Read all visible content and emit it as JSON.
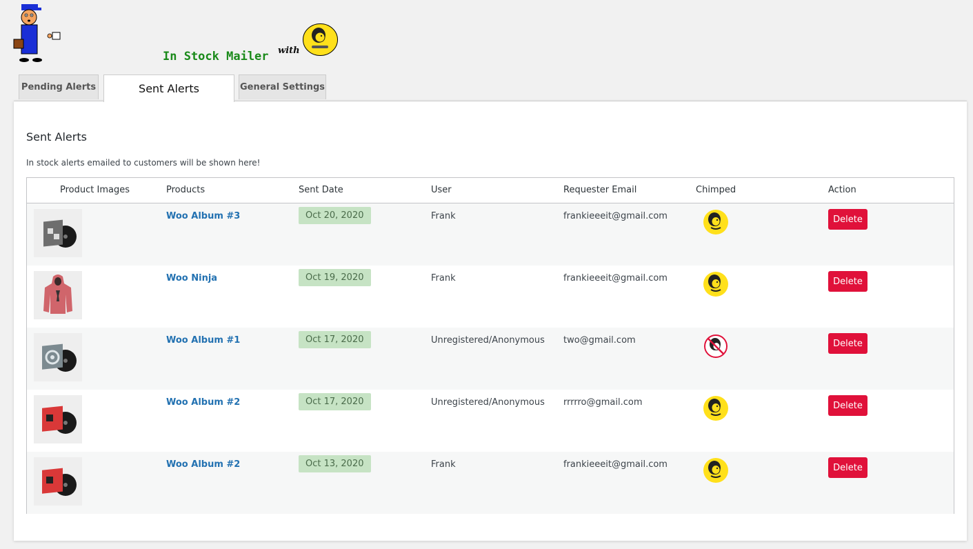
{
  "brand": {
    "title": "In Stock Mailer",
    "with_text": "with"
  },
  "tabs": [
    {
      "label": "Pending Alerts",
      "active": false
    },
    {
      "label": "Sent Alerts",
      "active": true
    },
    {
      "label": "General Settings",
      "active": false
    }
  ],
  "panel": {
    "title": "Sent Alerts",
    "description": "In stock alerts emailed to customers will be shown here!"
  },
  "table": {
    "headers": [
      "Product Images",
      "Products",
      "Sent Date",
      "User",
      "Requester Email",
      "Chimped",
      "Action"
    ],
    "rows": [
      {
        "image_icon": "album-3-icon",
        "product": "Woo Album #3",
        "date": "Oct 20, 2020",
        "user": "Frank",
        "email": "frankieeeit@gmail.com",
        "chimped": true,
        "action": "Delete"
      },
      {
        "image_icon": "ninja-hoodie-icon",
        "product": "Woo Ninja",
        "date": "Oct 19, 2020",
        "user": "Frank",
        "email": "frankieeeit@gmail.com",
        "chimped": true,
        "action": "Delete"
      },
      {
        "image_icon": "album-1-icon",
        "product": "Woo Album #1",
        "date": "Oct 17, 2020",
        "user": "Unregistered/Anonymous",
        "email": "two@gmail.com",
        "chimped": false,
        "action": "Delete"
      },
      {
        "image_icon": "album-2-icon",
        "product": "Woo Album #2",
        "date": "Oct 17, 2020",
        "user": "Unregistered/Anonymous",
        "email": "rrrrro@gmail.com",
        "chimped": true,
        "action": "Delete"
      },
      {
        "image_icon": "album-2-icon",
        "product": "Woo Album #2",
        "date": "Oct 13, 2020",
        "user": "Frank",
        "email": "frankieeeit@gmail.com",
        "chimped": true,
        "action": "Delete"
      }
    ]
  },
  "colors": {
    "brand_green": "#1a8a1a",
    "link_blue": "#2271b1",
    "delete_red": "#e0113a",
    "date_badge_bg": "#c6e3c4",
    "mailchimp_yellow": "#ffe01b"
  }
}
